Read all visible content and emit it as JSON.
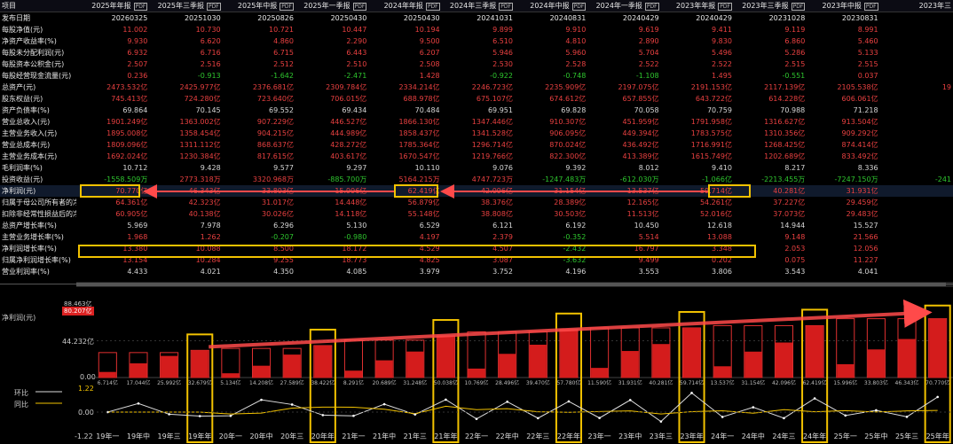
{
  "table": {
    "header_label": "项目",
    "pdf": "PDF",
    "columns": [
      "2025年年报",
      "2025年三季报",
      "2025年中报",
      "2025年一季报",
      "2024年年报",
      "2024年三季报",
      "2024年中报",
      "2024年一季报",
      "2023年年报",
      "2023年三季报",
      "2023年中报",
      "2023年三"
    ],
    "rows": [
      {
        "label": "发布日期",
        "cls": "date",
        "values": [
          "20260325",
          "20251030",
          "20250826",
          "20250430",
          "20250430",
          "20241031",
          "20240831",
          "20240429",
          "20240429",
          "20231028",
          "20230831",
          ""
        ]
      },
      {
        "label": "每股净值(元)",
        "values": [
          "11.002",
          "10.730",
          "10.721",
          "10.447",
          "10.194",
          "9.899",
          "9.910",
          "9.619",
          "9.411",
          "9.119",
          "8.991",
          ""
        ]
      },
      {
        "label": "净资产收益率(%)",
        "values": [
          "9.930",
          "6.620",
          "4.860",
          "2.290",
          "9.500",
          "6.510",
          "4.810",
          "2.890",
          "9.830",
          "6.860",
          "5.460",
          ""
        ]
      },
      {
        "label": "每股未分配利润(元)",
        "values": [
          "6.932",
          "6.716",
          "6.715",
          "6.443",
          "6.207",
          "5.946",
          "5.960",
          "5.704",
          "5.496",
          "5.286",
          "5.133",
          ""
        ]
      },
      {
        "label": "每股资本公积金(元)",
        "values": [
          "2.507",
          "2.516",
          "2.512",
          "2.510",
          "2.508",
          "2.530",
          "2.528",
          "2.522",
          "2.522",
          "2.515",
          "2.515",
          ""
        ]
      },
      {
        "label": "每股经营现金流量(元)",
        "values": [
          "0.236",
          "-0.913",
          "-1.642",
          "-2.471",
          "1.428",
          "-0.922",
          "-0.748",
          "-1.108",
          "1.495",
          "-0.551",
          "0.037",
          ""
        ]
      },
      {
        "label": "总资产(元)",
        "values": [
          "2473.532亿",
          "2425.977亿",
          "2376.681亿",
          "2309.784亿",
          "2334.214亿",
          "2246.723亿",
          "2235.909亿",
          "2197.075亿",
          "2191.153亿",
          "2117.139亿",
          "2105.538亿",
          "19"
        ]
      },
      {
        "label": "股东权益(元)",
        "values": [
          "745.413亿",
          "724.280亿",
          "723.640亿",
          "706.015亿",
          "688.978亿",
          "675.107亿",
          "674.612亿",
          "657.855亿",
          "643.722亿",
          "614.228亿",
          "606.061亿",
          ""
        ]
      },
      {
        "label": "资产负债率(%)",
        "values": [
          "69.864",
          "70.145",
          "69.552",
          "69.434",
          "70.484",
          "69.951",
          "69.828",
          "70.058",
          "70.759",
          "70.988",
          "71.218",
          ""
        ]
      },
      {
        "label": "营业总收入(元)",
        "values": [
          "1901.249亿",
          "1363.002亿",
          "907.229亿",
          "446.527亿",
          "1866.130亿",
          "1347.446亿",
          "910.307亿",
          "451.959亿",
          "1791.958亿",
          "1316.627亿",
          "913.504亿",
          ""
        ]
      },
      {
        "label": "主营业务收入(元)",
        "values": [
          "1895.008亿",
          "1358.454亿",
          "904.215亿",
          "444.989亿",
          "1858.437亿",
          "1341.528亿",
          "906.095亿",
          "449.394亿",
          "1783.575亿",
          "1310.356亿",
          "909.292亿",
          ""
        ]
      },
      {
        "label": "营业总成本(元)",
        "values": [
          "1809.096亿",
          "1311.112亿",
          "868.637亿",
          "428.272亿",
          "1785.364亿",
          "1296.714亿",
          "870.024亿",
          "436.492亿",
          "1716.991亿",
          "1268.425亿",
          "874.414亿",
          ""
        ]
      },
      {
        "label": "主营业务成本(元)",
        "values": [
          "1692.024亿",
          "1230.384亿",
          "817.615亿",
          "403.617亿",
          "1670.547亿",
          "1219.766亿",
          "822.300亿",
          "413.389亿",
          "1615.749亿",
          "1202.689亿",
          "833.492亿",
          ""
        ]
      },
      {
        "label": "毛利润率(%)",
        "values": [
          "10.712",
          "9.428",
          "9.577",
          "9.297",
          "10.110",
          "9.076",
          "9.392",
          "8.012",
          "9.410",
          "8.217",
          "8.336",
          ""
        ]
      },
      {
        "label": "投资收益(元)",
        "values": [
          "-1558.509万",
          "2773.318万",
          "3320.968万",
          "-885.700万",
          "5164.215万",
          "4747.723万",
          "-1247.483万",
          "-612.030万",
          "-1.066亿",
          "-2213.455万",
          "-7247.150万",
          "-241"
        ]
      },
      {
        "label": "净利润(元)",
        "cls": "hl",
        "values": [
          "70.770亿",
          "46.343亿",
          "33.803亿",
          "15.996亿",
          "62.419亿",
          "42.096亿",
          "31.154亿",
          "13.537亿",
          "59.714亿",
          "40.281亿",
          "31.931亿",
          ""
        ]
      },
      {
        "label": "归属于母公司所有者的净利润",
        "values": [
          "64.361亿",
          "42.323亿",
          "31.017亿",
          "14.448亿",
          "56.879亿",
          "38.376亿",
          "28.389亿",
          "12.165亿",
          "54.261亿",
          "37.227亿",
          "29.459亿",
          ""
        ]
      },
      {
        "label": "扣除非经常性损益后的净利润",
        "values": [
          "60.905亿",
          "40.138亿",
          "30.026亿",
          "14.118亿",
          "55.148亿",
          "38.808亿",
          "30.503亿",
          "11.513亿",
          "52.016亿",
          "37.073亿",
          "29.483亿",
          ""
        ]
      },
      {
        "label": "总资产增长率(%)",
        "values": [
          "5.969",
          "7.978",
          "6.296",
          "5.130",
          "6.529",
          "6.121",
          "6.192",
          "10.450",
          "12.618",
          "14.944",
          "15.527",
          ""
        ]
      },
      {
        "label": "主营业务增长率(%)",
        "values": [
          "1.968",
          "1.262",
          "-0.207",
          "-0.980",
          "4.197",
          "2.379",
          "-0.352",
          "5.514",
          "13.088",
          "9.148",
          "21.566",
          ""
        ]
      },
      {
        "label": "净利润增长率(%)",
        "values": [
          "13.380",
          "10.088",
          "8.500",
          "18.172",
          "4.529",
          "4.507",
          "-2.432",
          "16.797",
          "3.348",
          "2.053",
          "12.056",
          ""
        ]
      },
      {
        "label": "归属净利润增长率(%)",
        "values": [
          "13.154",
          "10.284",
          "9.255",
          "18.773",
          "4.825",
          "3.087",
          "-3.632",
          "9.499",
          "0.202",
          "0.075",
          "11.227",
          ""
        ]
      },
      {
        "label": "营业利润率(%)",
        "values": [
          "4.433",
          "4.021",
          "4.350",
          "4.085",
          "3.979",
          "3.752",
          "4.196",
          "3.553",
          "3.806",
          "3.543",
          "4.041",
          ""
        ]
      }
    ]
  },
  "chart": {
    "title": "净利润(元)",
    "ymax_label": "88.463亿",
    "cursor_label": "80.207亿",
    "ymid_label": "44.232亿",
    "yzero_label": "0.00",
    "line_title_1": "环比",
    "line_title_2": "同比",
    "line_top_label": "1.22",
    "line_zero_label": "0.00",
    "line_bottom_label": "-1.22",
    "accent_color": "#f2c200",
    "arrow_color": "#ff4a4a"
  },
  "chart_data": {
    "type": "bar",
    "ylim": [
      0,
      88.463
    ],
    "bars": [
      {
        "q": "19年一",
        "ytd": 6.714,
        "annual": 30.0
      },
      {
        "q": "19年中",
        "ytd": 17.044,
        "annual": 30.0
      },
      {
        "q": "19年三",
        "ytd": 25.992,
        "annual": 30.0
      },
      {
        "q": "19年年",
        "ytd": 32.679,
        "annual": 32.679
      },
      {
        "q": "20年一",
        "ytd": 5.134,
        "annual": 35.0
      },
      {
        "q": "20年中",
        "ytd": 14.208,
        "annual": 35.0
      },
      {
        "q": "20年三",
        "ytd": 27.589,
        "annual": 35.0
      },
      {
        "q": "20年年",
        "ytd": 38.422,
        "annual": 38.422
      },
      {
        "q": "21年一",
        "ytd": 8.291,
        "annual": 45.0
      },
      {
        "q": "21年中",
        "ytd": 20.689,
        "annual": 45.0
      },
      {
        "q": "21年三",
        "ytd": 31.248,
        "annual": 45.0
      },
      {
        "q": "21年年",
        "ytd": 50.038,
        "annual": 50.038
      },
      {
        "q": "22年一",
        "ytd": 10.769,
        "annual": 55.0
      },
      {
        "q": "22年中",
        "ytd": 28.496,
        "annual": 55.0
      },
      {
        "q": "22年三",
        "ytd": 39.47,
        "annual": 55.0
      },
      {
        "q": "22年年",
        "ytd": 57.78,
        "annual": 57.78
      },
      {
        "q": "23年一",
        "ytd": 11.59,
        "annual": 59.714
      },
      {
        "q": "23年中",
        "ytd": 31.931,
        "annual": 59.714
      },
      {
        "q": "23年三",
        "ytd": 40.281,
        "annual": 59.714
      },
      {
        "q": "23年年",
        "ytd": 59.714,
        "annual": 59.714
      },
      {
        "q": "24年一",
        "ytd": 13.537,
        "annual": 62.419
      },
      {
        "q": "24年中",
        "ytd": 31.154,
        "annual": 62.419
      },
      {
        "q": "24年三",
        "ytd": 42.096,
        "annual": 62.419
      },
      {
        "q": "24年年",
        "ytd": 62.419,
        "annual": 62.419
      },
      {
        "q": "25年一",
        "ytd": 15.996,
        "annual": 70.77
      },
      {
        "q": "25年中",
        "ytd": 33.803,
        "annual": 70.77
      },
      {
        "q": "25年三",
        "ytd": 46.343,
        "annual": 70.77
      },
      {
        "q": "25年年",
        "ytd": 70.77,
        "annual": 70.77
      }
    ],
    "value_labels": [
      "6.714亿",
      "17.044亿",
      "25.992亿",
      "32.679亿",
      "5.134亿",
      "14.208亿",
      "27.589亿",
      "38.422亿",
      "8.291亿",
      "20.689亿",
      "31.248亿",
      "50.038亿",
      "10.769亿",
      "28.496亿",
      "39.470亿",
      "57.780亿",
      "11.590亿",
      "31.931亿",
      "40.281亿",
      "59.714亿",
      "13.537亿",
      "31.154亿",
      "42.096亿",
      "62.419亿",
      "15.996亿",
      "33.803亿",
      "46.343亿",
      "70.770亿"
    ],
    "highlight_annual": true
  }
}
